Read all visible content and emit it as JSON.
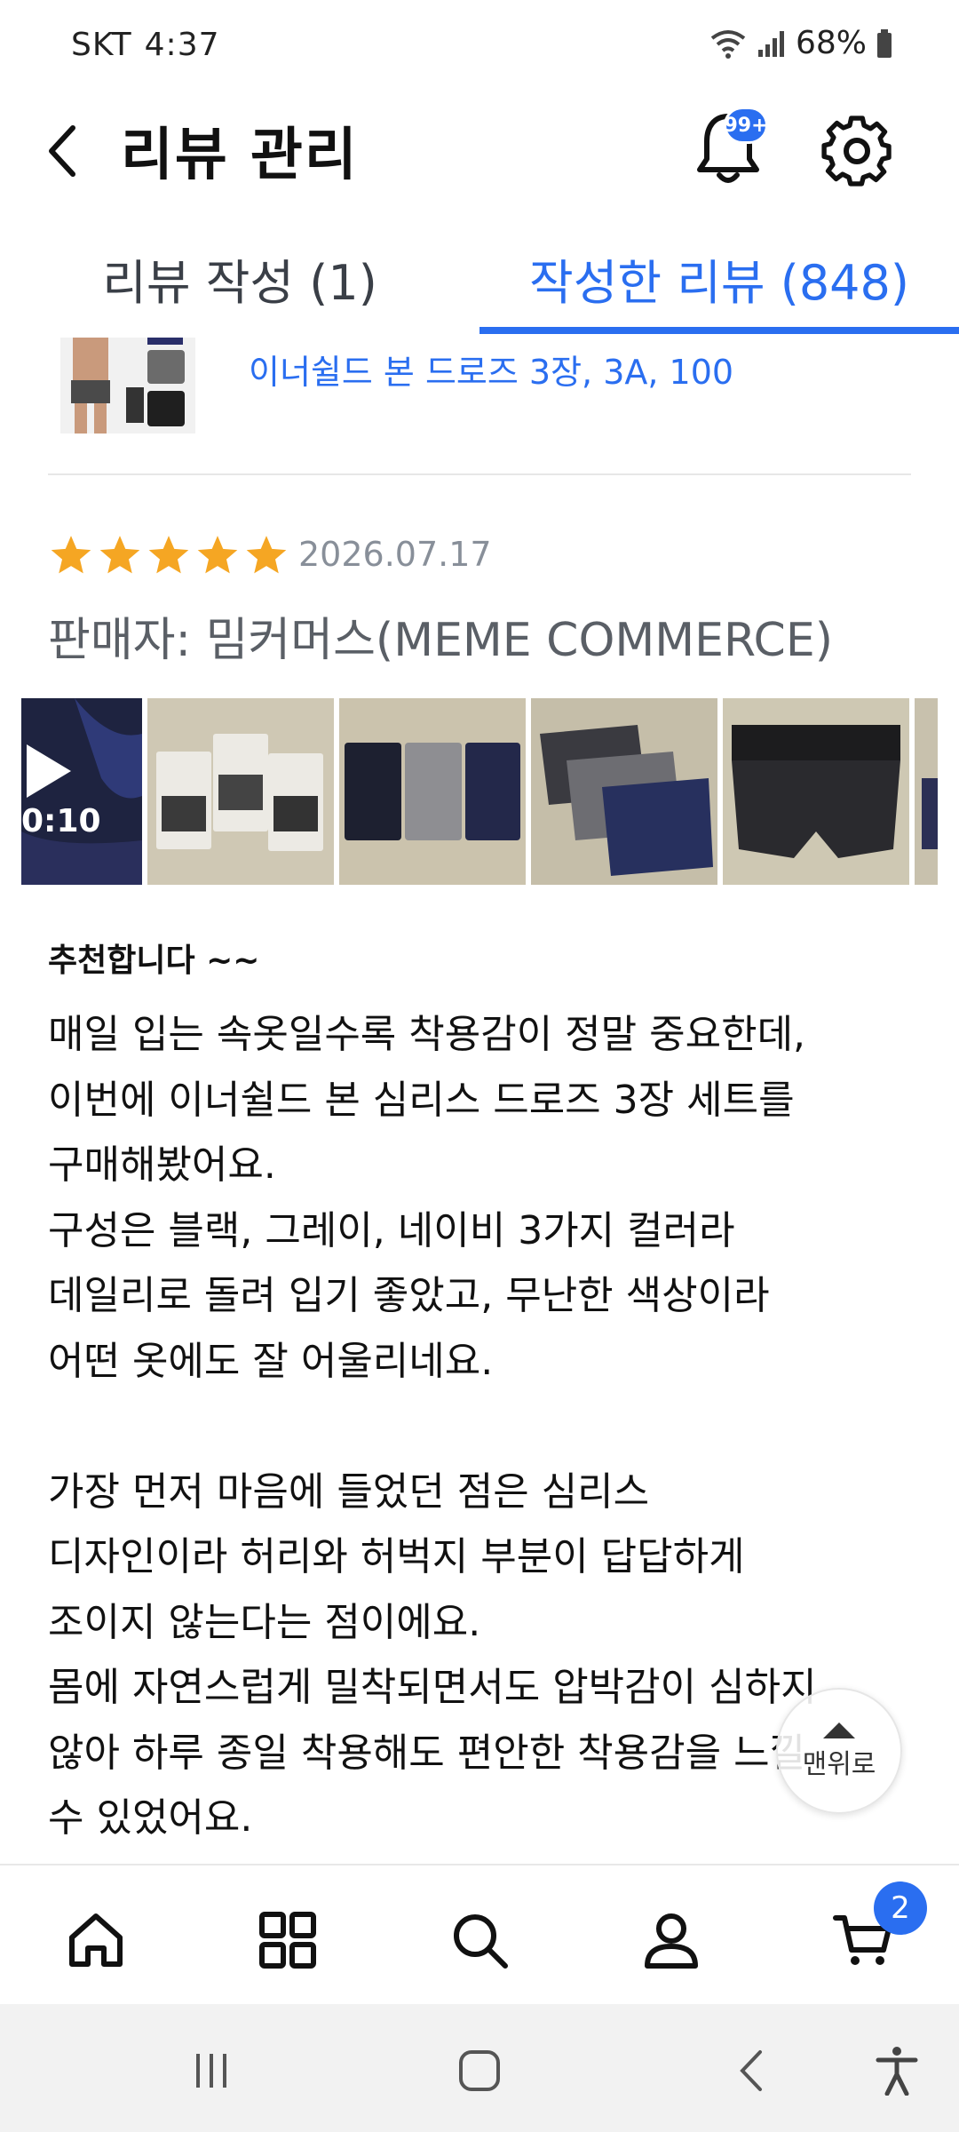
{
  "status_bar": {
    "carrier": "SKT",
    "time": "4:37",
    "battery": "68%"
  },
  "header": {
    "title": "리뷰 관리",
    "notification_badge": "99+"
  },
  "tabs": [
    {
      "label": "리뷰 작성 (1)",
      "active": false
    },
    {
      "label": "작성한 리뷰 (848)",
      "active": true
    }
  ],
  "product": {
    "name": "이너쉴드 본 드로즈 3장, 3A, 100"
  },
  "review": {
    "rating": 5,
    "date": "2026.07.17",
    "seller": "판매자: 밈커머스(MEME COMMERCE)",
    "video_duration": "0:10",
    "title": "추천합니다 ~~",
    "body_lines": [
      "매일 입는 속옷일수록 착용감이 정말 중요한데,",
      "이번에 이너쉴드 본 심리스 드로즈 3장 세트를",
      "구매해봤어요.",
      "구성은 블랙, 그레이, 네이비 3가지 컬러라",
      "데일리로 돌려 입기 좋았고, 무난한 색상이라",
      "어떤 옷에도 잘 어울리네요.",
      "",
      "가장 먼저 마음에 들었던 점은 심리스",
      "디자인이라 허리와 허벅지 부분이 답답하게",
      "조이지 않는다는 점이에요.",
      "몸에 자연스럽게 밀착되면서도 압박감이 심하지",
      "않아 하루 종일 착용해도 편안한 착용감을 느낄",
      "수 있었어요."
    ]
  },
  "scroll_top": {
    "label": "맨위로"
  },
  "bottom_nav": {
    "cart_count": "2"
  },
  "colors": {
    "accent": "#2a6ef0",
    "star": "#f5a623",
    "muted": "#888f99"
  }
}
